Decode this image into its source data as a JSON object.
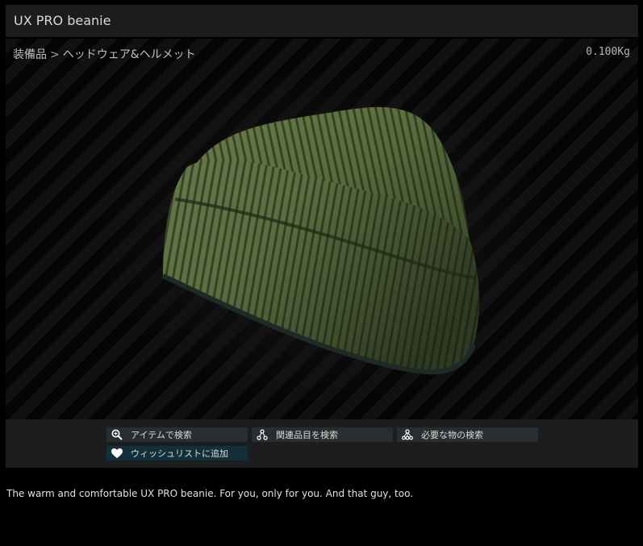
{
  "window": {
    "title": "UX PRO beanie"
  },
  "breadcrumb": {
    "category": "装備品",
    "separator": ">",
    "subcategory": "ヘッドウェア&ヘルメット"
  },
  "weight": "0.100Kg",
  "actions": {
    "search_items": {
      "label": "アイテムで検索",
      "icon": "magnifier-plus-icon"
    },
    "related_search": {
      "label": "関連品目を検索",
      "icon": "nodes-icon"
    },
    "required_search": {
      "label": "必要な物の検索",
      "icon": "tree-icon"
    },
    "wishlist": {
      "label": "ウィッシュリストに追加",
      "icon": "heart-icon"
    }
  },
  "description": "The warm and comfortable UX PRO beanie. For you, only for you. And that guy, too.",
  "colors": {
    "hat_green": "#5c6e3f",
    "hat_dark": "#2b3520",
    "panel": "#1b1d1e",
    "wish_button": "#13303a"
  }
}
